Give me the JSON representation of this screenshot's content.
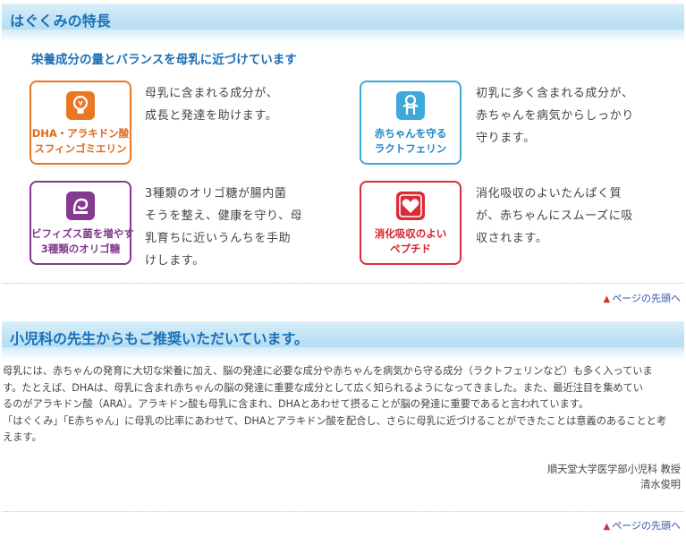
{
  "section1": {
    "title": "はぐくみの特長",
    "lead": "栄養成分の量とバランスを母乳に近づけています",
    "features": [
      {
        "label_line1": "DHA・アラキドン酸",
        "label_line2": "スフィンゴミエリン",
        "icon": "lightbulb-icon",
        "color": "#e97825",
        "desc_line1": "母乳に含まれる成分が、",
        "desc_line2": "成長と発達を助けます。"
      },
      {
        "label_line1": "赤ちゃんを守る",
        "label_line2": "ラクトフェリン",
        "icon": "baby-icon",
        "color": "#3ea8d9",
        "desc_line1": "初乳に多く含まれる成分が、",
        "desc_line2": "赤ちゃんを病気からしっかり",
        "desc_line3": "守ります。"
      },
      {
        "label_line1": "ビフィズス菌を増やす",
        "label_line2": "3種類のオリゴ糖",
        "icon": "swirl-icon",
        "color": "#843a8f",
        "desc_line1": "3種類のオリゴ糖が腸内菌",
        "desc_line2": "そうを整え、健康を守り、母",
        "desc_line3": "乳育ちに近いうんちを手助",
        "desc_line4": "けします。"
      },
      {
        "label_line1": "消化吸収のよい",
        "label_line2": "ペプチド",
        "icon": "heart-icon",
        "color": "#dd2b35",
        "desc_line1": "消化吸収のよいたんぱく質",
        "desc_line2": "が、赤ちゃんにスムーズに吸",
        "desc_line3": "収されます。"
      }
    ]
  },
  "page_top_link": "ページの先頭へ",
  "section2": {
    "title": "小児科の先生からもご推奨いただいています。",
    "body_lines": [
      "母乳には、赤ちゃんの発育に大切な栄養に加え、脳の発達に必要な成分や赤ちゃんを病気から守る成分（ラクトフェリンなど）も多く入っていま",
      "す。たとえば、DHAは、母乳に含まれ赤ちゃんの脳の発達に重要な成分として広く知られるようになってきました。また、最近注目を集めてい",
      "るのがアラキドン酸（ARA）。アラキドン酸も母乳に含まれ、DHAとあわせて摂ることが脳の発達に重要であると言われています。",
      "「はぐくみ」「E赤ちゃん」に母乳の比率にあわせて、DHAとアラキドン酸を配合し、さらに母乳に近づけることができたことは意義のあることと考",
      "えます。"
    ],
    "signature_affiliation": "順天堂大学医学部小児科 教授",
    "signature_name": "清水俊明"
  }
}
